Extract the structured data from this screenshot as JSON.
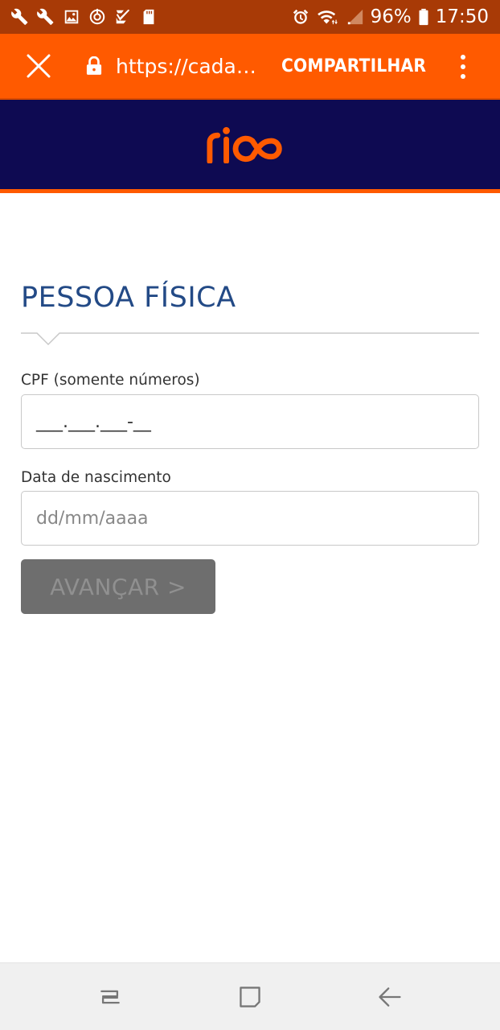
{
  "status_bar": {
    "battery": "96%",
    "time": "17:50"
  },
  "toolbar": {
    "url": "https://cadast…",
    "share_label": "COMPARTILHAR"
  },
  "brand": {
    "logo_text": "rico",
    "colors": {
      "orange": "#ff5a00",
      "navy": "#0e0a52",
      "title_blue": "#234a86"
    }
  },
  "form": {
    "title": "PESSOA FÍSICA",
    "cpf_label": "CPF (somente números)",
    "cpf_value": "___.___.___-__",
    "dob_label": "Data de nascimento",
    "dob_placeholder": "dd/mm/aaaa",
    "submit_label": "AVANÇAR >"
  }
}
